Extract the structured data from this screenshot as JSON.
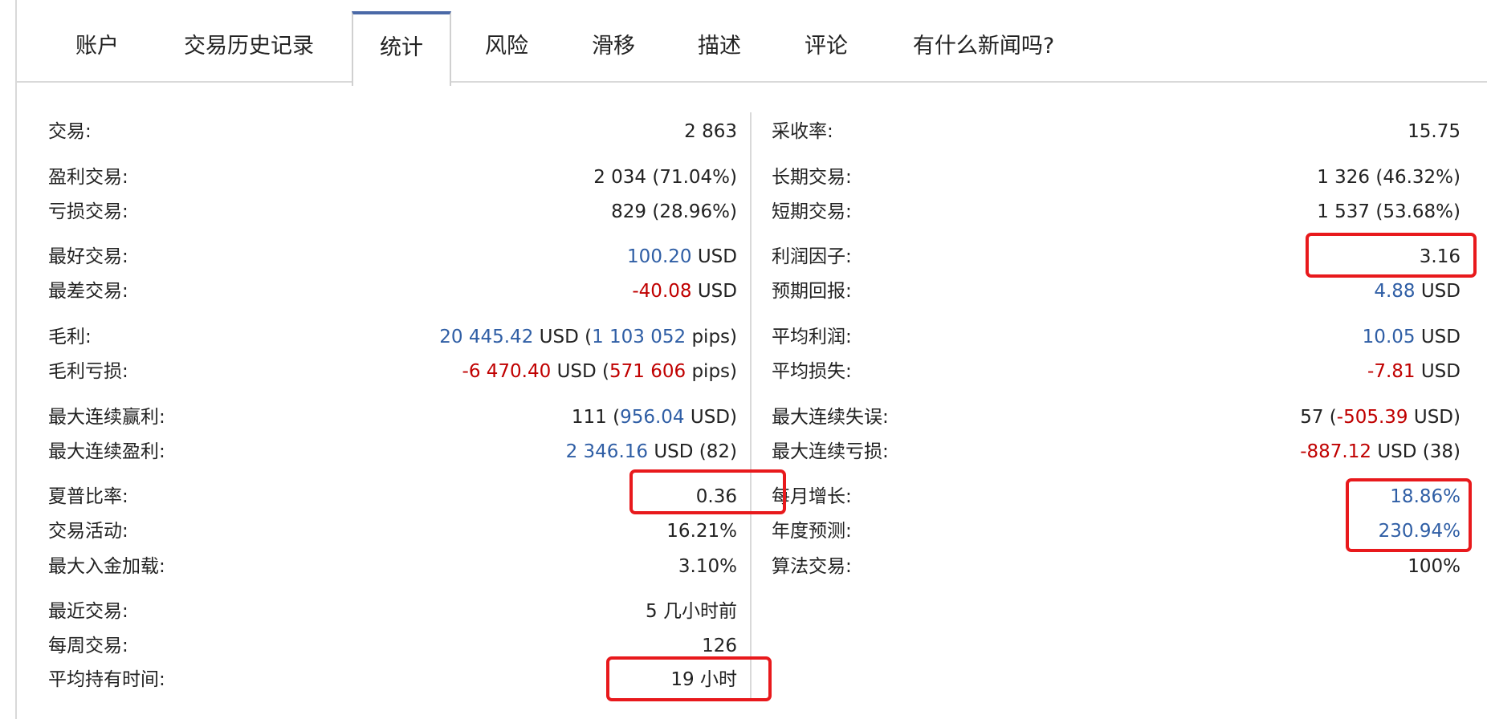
{
  "tabs": [
    {
      "label": "账户"
    },
    {
      "label": "交易历史记录"
    },
    {
      "label": "统计"
    },
    {
      "label": "风险"
    },
    {
      "label": "滑移"
    },
    {
      "label": "描述"
    },
    {
      "label": "评论"
    },
    {
      "label": "有什么新闻吗?"
    }
  ],
  "active_tab": "统计",
  "colors": {
    "positive": "#2f5ea5",
    "negative": "#c00000",
    "highlight": "#e8191c",
    "tab_accent": "#4a69a7"
  },
  "left": {
    "trades": {
      "label": "交易:",
      "value": "2 863"
    },
    "profit_trades": {
      "label": "盈利交易:",
      "value": "2 034 (71.04%)"
    },
    "loss_trades": {
      "label": "亏损交易:",
      "value": "829 (28.96%)"
    },
    "best_trade": {
      "label": "最好交易:",
      "amount": "100.20",
      "unit": " USD"
    },
    "worst_trade": {
      "label": "最差交易:",
      "amount": "-40.08",
      "unit": " USD"
    },
    "gross_profit": {
      "label": "毛利:",
      "amount": "20 445.42",
      "mid": " USD (",
      "pips": "1 103 052",
      "end": " pips)"
    },
    "gross_loss": {
      "label": "毛利亏损:",
      "amount": "-6 470.40",
      "mid": " USD (",
      "pips": "571 606",
      "end": " pips)"
    },
    "max_consec_wins": {
      "label": "最大连续赢利:",
      "count": "111 (",
      "amount": "956.04",
      "end": " USD)"
    },
    "max_consec_profit": {
      "label": "最大连续盈利:",
      "amount": "2 346.16",
      "end": " USD (82)"
    },
    "sharpe": {
      "label": "夏普比率:",
      "value": "0.36"
    },
    "activity": {
      "label": "交易活动:",
      "value": "16.21%"
    },
    "max_deposit_load": {
      "label": "最大入金加载:",
      "value": "3.10%"
    },
    "latest_trade": {
      "label": "最近交易:",
      "value": "5 几小时前"
    },
    "trades_per_week": {
      "label": "每周交易:",
      "value": "126"
    },
    "avg_holding": {
      "label": "平均持有时间:",
      "value": "19 小时"
    }
  },
  "right": {
    "recovery": {
      "label": "采收率:",
      "value": "15.75"
    },
    "long_trades": {
      "label": "长期交易:",
      "value": "1 326 (46.32%)"
    },
    "short_trades": {
      "label": "短期交易:",
      "value": "1 537 (53.68%)"
    },
    "profit_factor": {
      "label": "利润因子:",
      "value": "3.16"
    },
    "expected_payoff": {
      "label": "预期回报:",
      "amount": "4.88",
      "unit": " USD"
    },
    "avg_profit": {
      "label": "平均利润:",
      "amount": "10.05",
      "unit": " USD"
    },
    "avg_loss": {
      "label": "平均损失:",
      "amount": "-7.81",
      "unit": " USD"
    },
    "max_consec_losses": {
      "label": "最大连续失误:",
      "count": "57 (",
      "amount": "-505.39",
      "end": " USD)"
    },
    "max_consec_loss": {
      "label": "最大连续亏损:",
      "amount": "-887.12",
      "end": " USD (38)"
    },
    "monthly_growth": {
      "label": "每月增长:",
      "value": "18.86%"
    },
    "annual_forecast": {
      "label": "年度预测:",
      "value": "230.94%"
    },
    "algo_trading": {
      "label": "算法交易:",
      "value": "100%"
    }
  }
}
